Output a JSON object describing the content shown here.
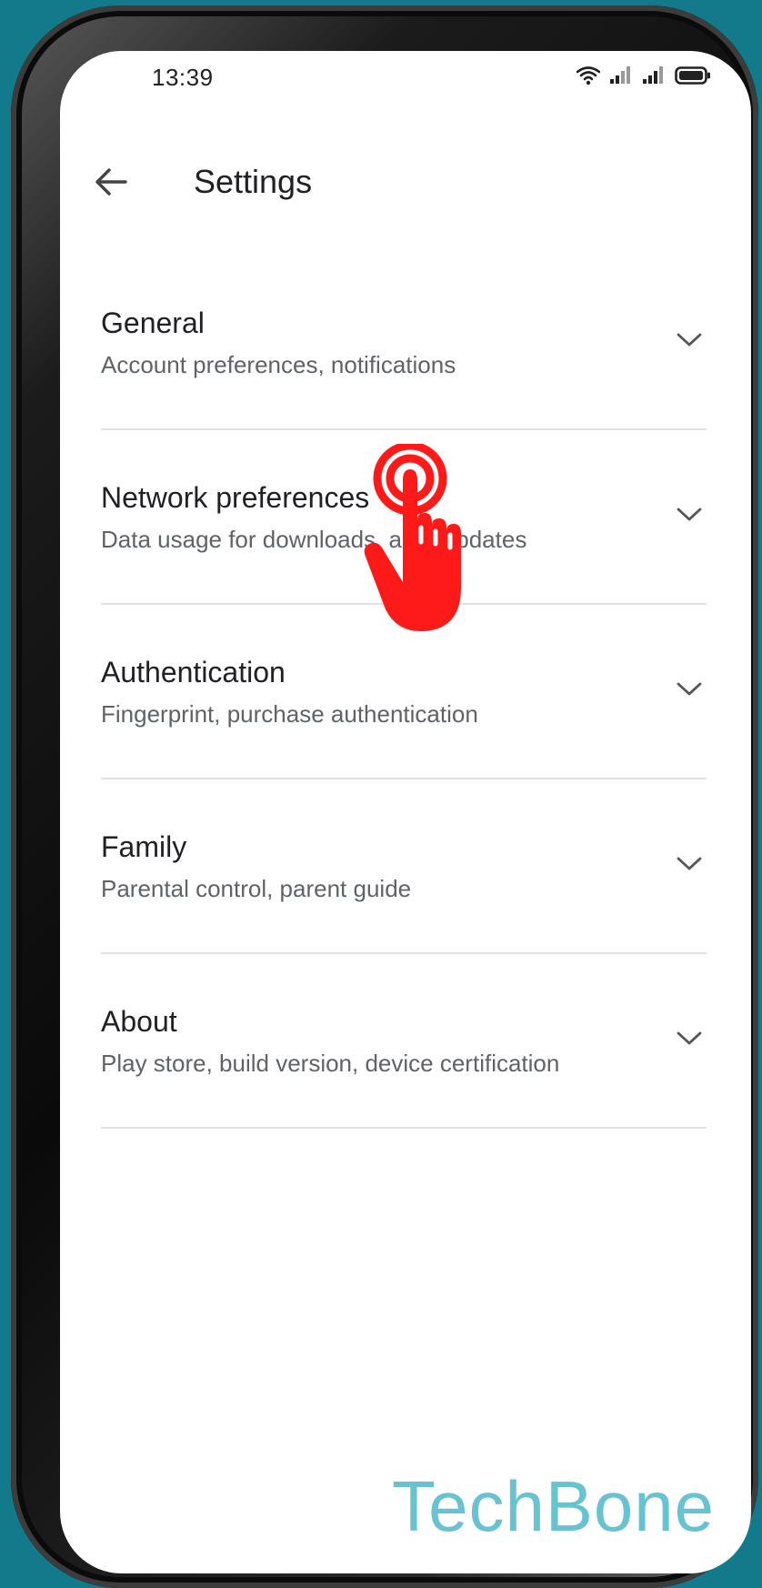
{
  "status_bar": {
    "time": "13:39",
    "icons": [
      "wifi-icon",
      "signal-icon",
      "signal-icon",
      "battery-icon"
    ]
  },
  "app_bar": {
    "back_icon": "arrow-back-icon",
    "title": "Settings"
  },
  "settings_items": [
    {
      "title": "General",
      "subtitle": "Account preferences, notifications"
    },
    {
      "title": "Network preferences",
      "subtitle": "Data usage for downloads, auto-updates"
    },
    {
      "title": "Authentication",
      "subtitle": "Fingerprint, purchase authentication"
    },
    {
      "title": "Family",
      "subtitle": "Parental control, parent guide"
    },
    {
      "title": "About",
      "subtitle": "Play store, build version, device certification"
    }
  ],
  "overlay": {
    "tap_indicator_icon": "tap-hand-icon",
    "watermark": "TechBone"
  },
  "colors": {
    "background": "#127a8a",
    "tap_indicator": "#ff1a1a",
    "watermark": "#67c2d2"
  }
}
